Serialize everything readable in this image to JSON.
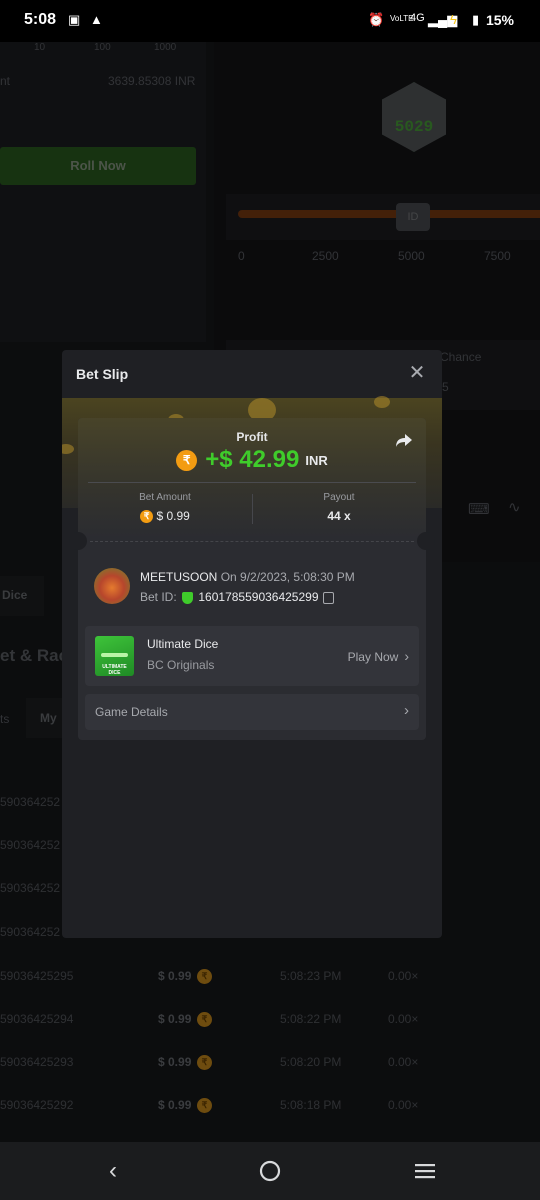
{
  "status_bar": {
    "time": "5:08",
    "battery": "15%",
    "network": "4G"
  },
  "background": {
    "slider_ticks": [
      "0",
      "2500",
      "5000",
      "7500"
    ],
    "amount_value": "3639.85308 INR",
    "scale_labels": [
      "10",
      "100",
      "1000"
    ],
    "dice_number": "5029",
    "roll_button": "Roll Now",
    "chance_label": "Chance",
    "chance_value": "5",
    "dice_tab": "Dice",
    "section_title": "et & Rac",
    "tab_my": "My",
    "tab_partial": "ts",
    "rows": [
      {
        "id": "590364252",
        "amount": "",
        "time": "",
        "payout": ""
      },
      {
        "id": "590364252",
        "amount": "",
        "time": "",
        "payout": ""
      },
      {
        "id": "590364252",
        "amount": "",
        "time": "",
        "payout": ""
      },
      {
        "id": "590364252",
        "amount": "",
        "time": "",
        "payout": ""
      },
      {
        "id": "59036425295",
        "amount": "$ 0.99",
        "time": "5:08:23 PM",
        "payout": "0.00×"
      },
      {
        "id": "59036425294",
        "amount": "$ 0.99",
        "time": "5:08:22 PM",
        "payout": "0.00×"
      },
      {
        "id": "59036425293",
        "amount": "$ 0.99",
        "time": "5:08:20 PM",
        "payout": "0.00×"
      },
      {
        "id": "59036425292",
        "amount": "$ 0.99",
        "time": "5:08:18 PM",
        "payout": "0.00×"
      }
    ]
  },
  "modal": {
    "title": "Bet Slip",
    "profit_label": "Profit",
    "profit_amount": "+$ 42.99",
    "currency": "INR",
    "bet_amount_label": "Bet Amount",
    "bet_amount_value": "$ 0.99",
    "payout_label": "Payout",
    "payout_value": "44 x",
    "username": "MEETUSOON",
    "bet_date": "On 9/2/2023, 5:08:30 PM",
    "bet_id_label": "Bet ID:",
    "bet_id_value": "160178559036425299",
    "game_name": "Ultimate Dice",
    "game_provider": "BC Originals",
    "game_thumb_text": "ULTIMATE DICE",
    "play_now": "Play Now",
    "game_details": "Game Details"
  },
  "colors": {
    "profit_green": "#3fcc2b",
    "coin_orange": "#f39c12",
    "modal_bg": "#1f2024"
  }
}
